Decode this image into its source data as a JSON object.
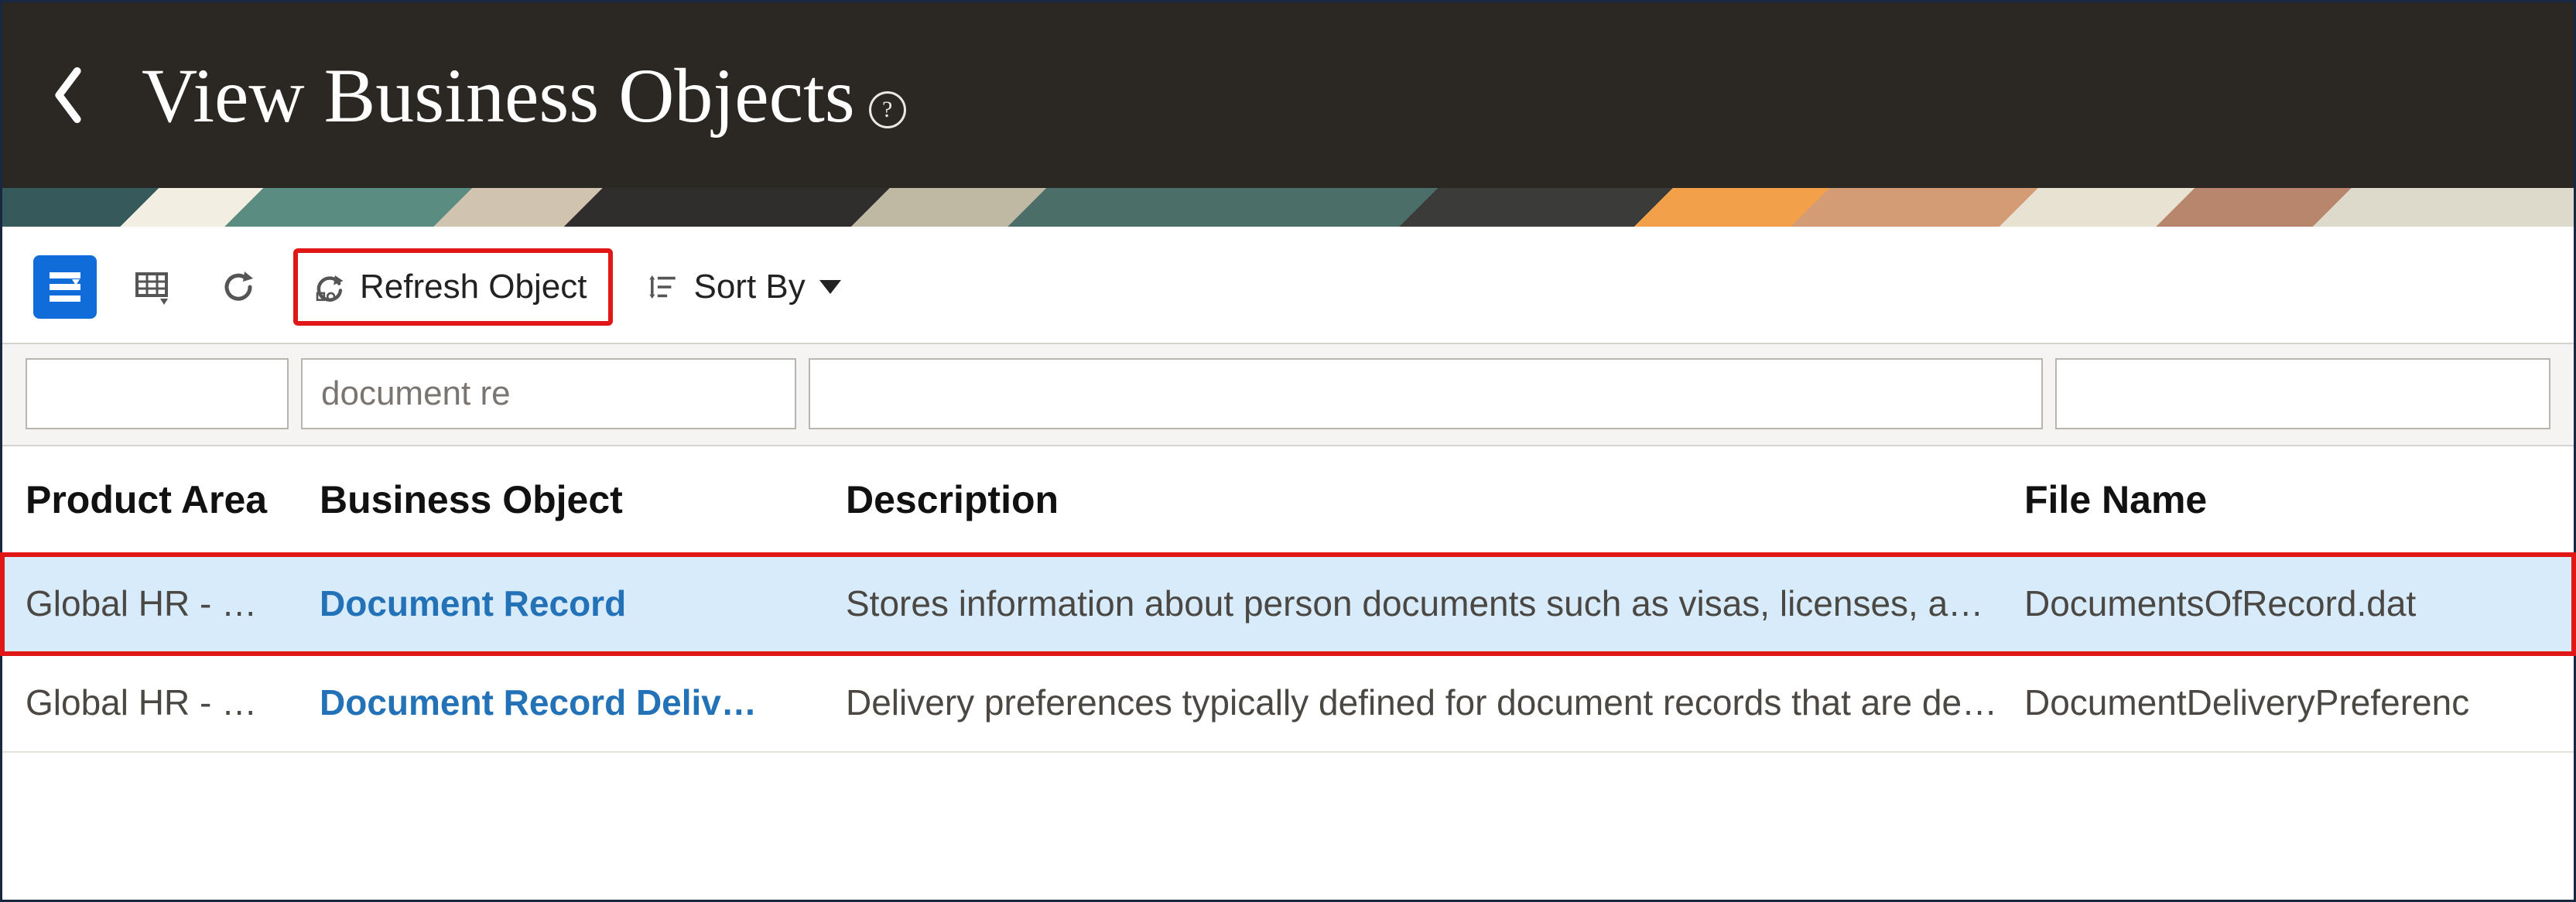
{
  "header": {
    "title": "View Business Objects",
    "help_glyph": "?"
  },
  "toolbar": {
    "refresh_object_label": "Refresh Object",
    "sort_by_label": "Sort By"
  },
  "filters": {
    "product_area_value": "",
    "business_object_value": "document re",
    "description_value": "",
    "file_name_value": ""
  },
  "table": {
    "columns": {
      "product_area": "Product Area",
      "business_object": "Business Object",
      "description": "Description",
      "file_name": "File Name"
    },
    "rows": [
      {
        "product_area": "Global HR - …",
        "business_object": "Document Record",
        "description": "Stores information about person documents such as visas, licenses, and…",
        "file_name": "DocumentsOfRecord.dat",
        "selected": true
      },
      {
        "product_area": "Global HR - …",
        "business_object": "Document Record Deliv…",
        "description": "Delivery preferences typically defined for document records that are deli…",
        "file_name": "DocumentDeliveryPreferenc",
        "selected": false
      }
    ]
  }
}
